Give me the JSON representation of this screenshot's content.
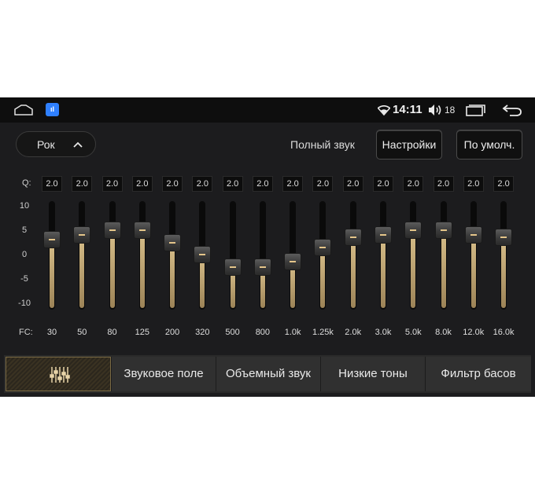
{
  "status_bar": {
    "time": "14:11",
    "volume": "18",
    "app_icon": "app-icon"
  },
  "header": {
    "preset": "Рок",
    "full_sound": "Полный звук",
    "settings_button": "Настройки",
    "default_button": "По умолч."
  },
  "eq": {
    "q_label": "Q:",
    "fc_label": "FC:",
    "y_ticks": [
      "10",
      "5",
      "0",
      "-5",
      "-10"
    ],
    "range": [
      -10,
      10
    ],
    "bands": [
      {
        "fc": "30",
        "q": "2.0",
        "gain": 3
      },
      {
        "fc": "50",
        "q": "2.0",
        "gain": 4
      },
      {
        "fc": "80",
        "q": "2.0",
        "gain": 5
      },
      {
        "fc": "125",
        "q": "2.0",
        "gain": 5
      },
      {
        "fc": "200",
        "q": "2.0",
        "gain": 2.5
      },
      {
        "fc": "320",
        "q": "2.0",
        "gain": 0
      },
      {
        "fc": "500",
        "q": "2.0",
        "gain": -2.5
      },
      {
        "fc": "800",
        "q": "2.0",
        "gain": -2.5
      },
      {
        "fc": "1.0k",
        "q": "2.0",
        "gain": -1.5
      },
      {
        "fc": "1.25k",
        "q": "2.0",
        "gain": 1.5
      },
      {
        "fc": "2.0k",
        "q": "2.0",
        "gain": 3.5
      },
      {
        "fc": "3.0k",
        "q": "2.0",
        "gain": 4
      },
      {
        "fc": "5.0k",
        "q": "2.0",
        "gain": 5
      },
      {
        "fc": "8.0k",
        "q": "2.0",
        "gain": 5
      },
      {
        "fc": "12.0k",
        "q": "2.0",
        "gain": 4
      },
      {
        "fc": "16.0k",
        "q": "2.0",
        "gain": 3.5
      }
    ]
  },
  "tabs": {
    "equalizer_icon": "equalizer-icon",
    "sound_field": "Звуковое поле",
    "surround": "Объемный звук",
    "bass_tones": "Низкие тоны",
    "bass_filter": "Фильтр басов"
  },
  "colors": {
    "accent": "#d8bf8a",
    "background": "#1c1c1e"
  }
}
